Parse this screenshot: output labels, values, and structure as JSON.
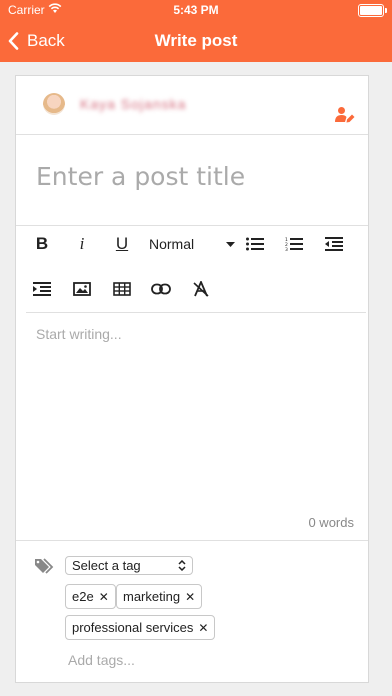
{
  "status_bar": {
    "carrier": "Carrier",
    "time": "5:43 PM"
  },
  "nav": {
    "back_label": "Back",
    "title": "Write post"
  },
  "author": {
    "name": "Kaya Sojanska"
  },
  "post": {
    "title_placeholder": "Enter a post title"
  },
  "toolbar": {
    "bold": "B",
    "italic": "i",
    "underline": "U",
    "size_value": "Normal",
    "icons": [
      "bullet-list-icon",
      "ordered-list-icon",
      "outdent-icon",
      "indent-icon",
      "image-icon",
      "table-icon",
      "link-icon",
      "clear-format-icon"
    ]
  },
  "editor": {
    "placeholder": "Start writing...",
    "word_count": "0 words"
  },
  "tags": {
    "select_value": "Select a tag",
    "chips": [
      "e2e",
      "marketing",
      "professional services"
    ],
    "remove_glyph": "✕",
    "add_placeholder": "Add tags..."
  },
  "colors": {
    "brand": "#fb6a3a"
  }
}
